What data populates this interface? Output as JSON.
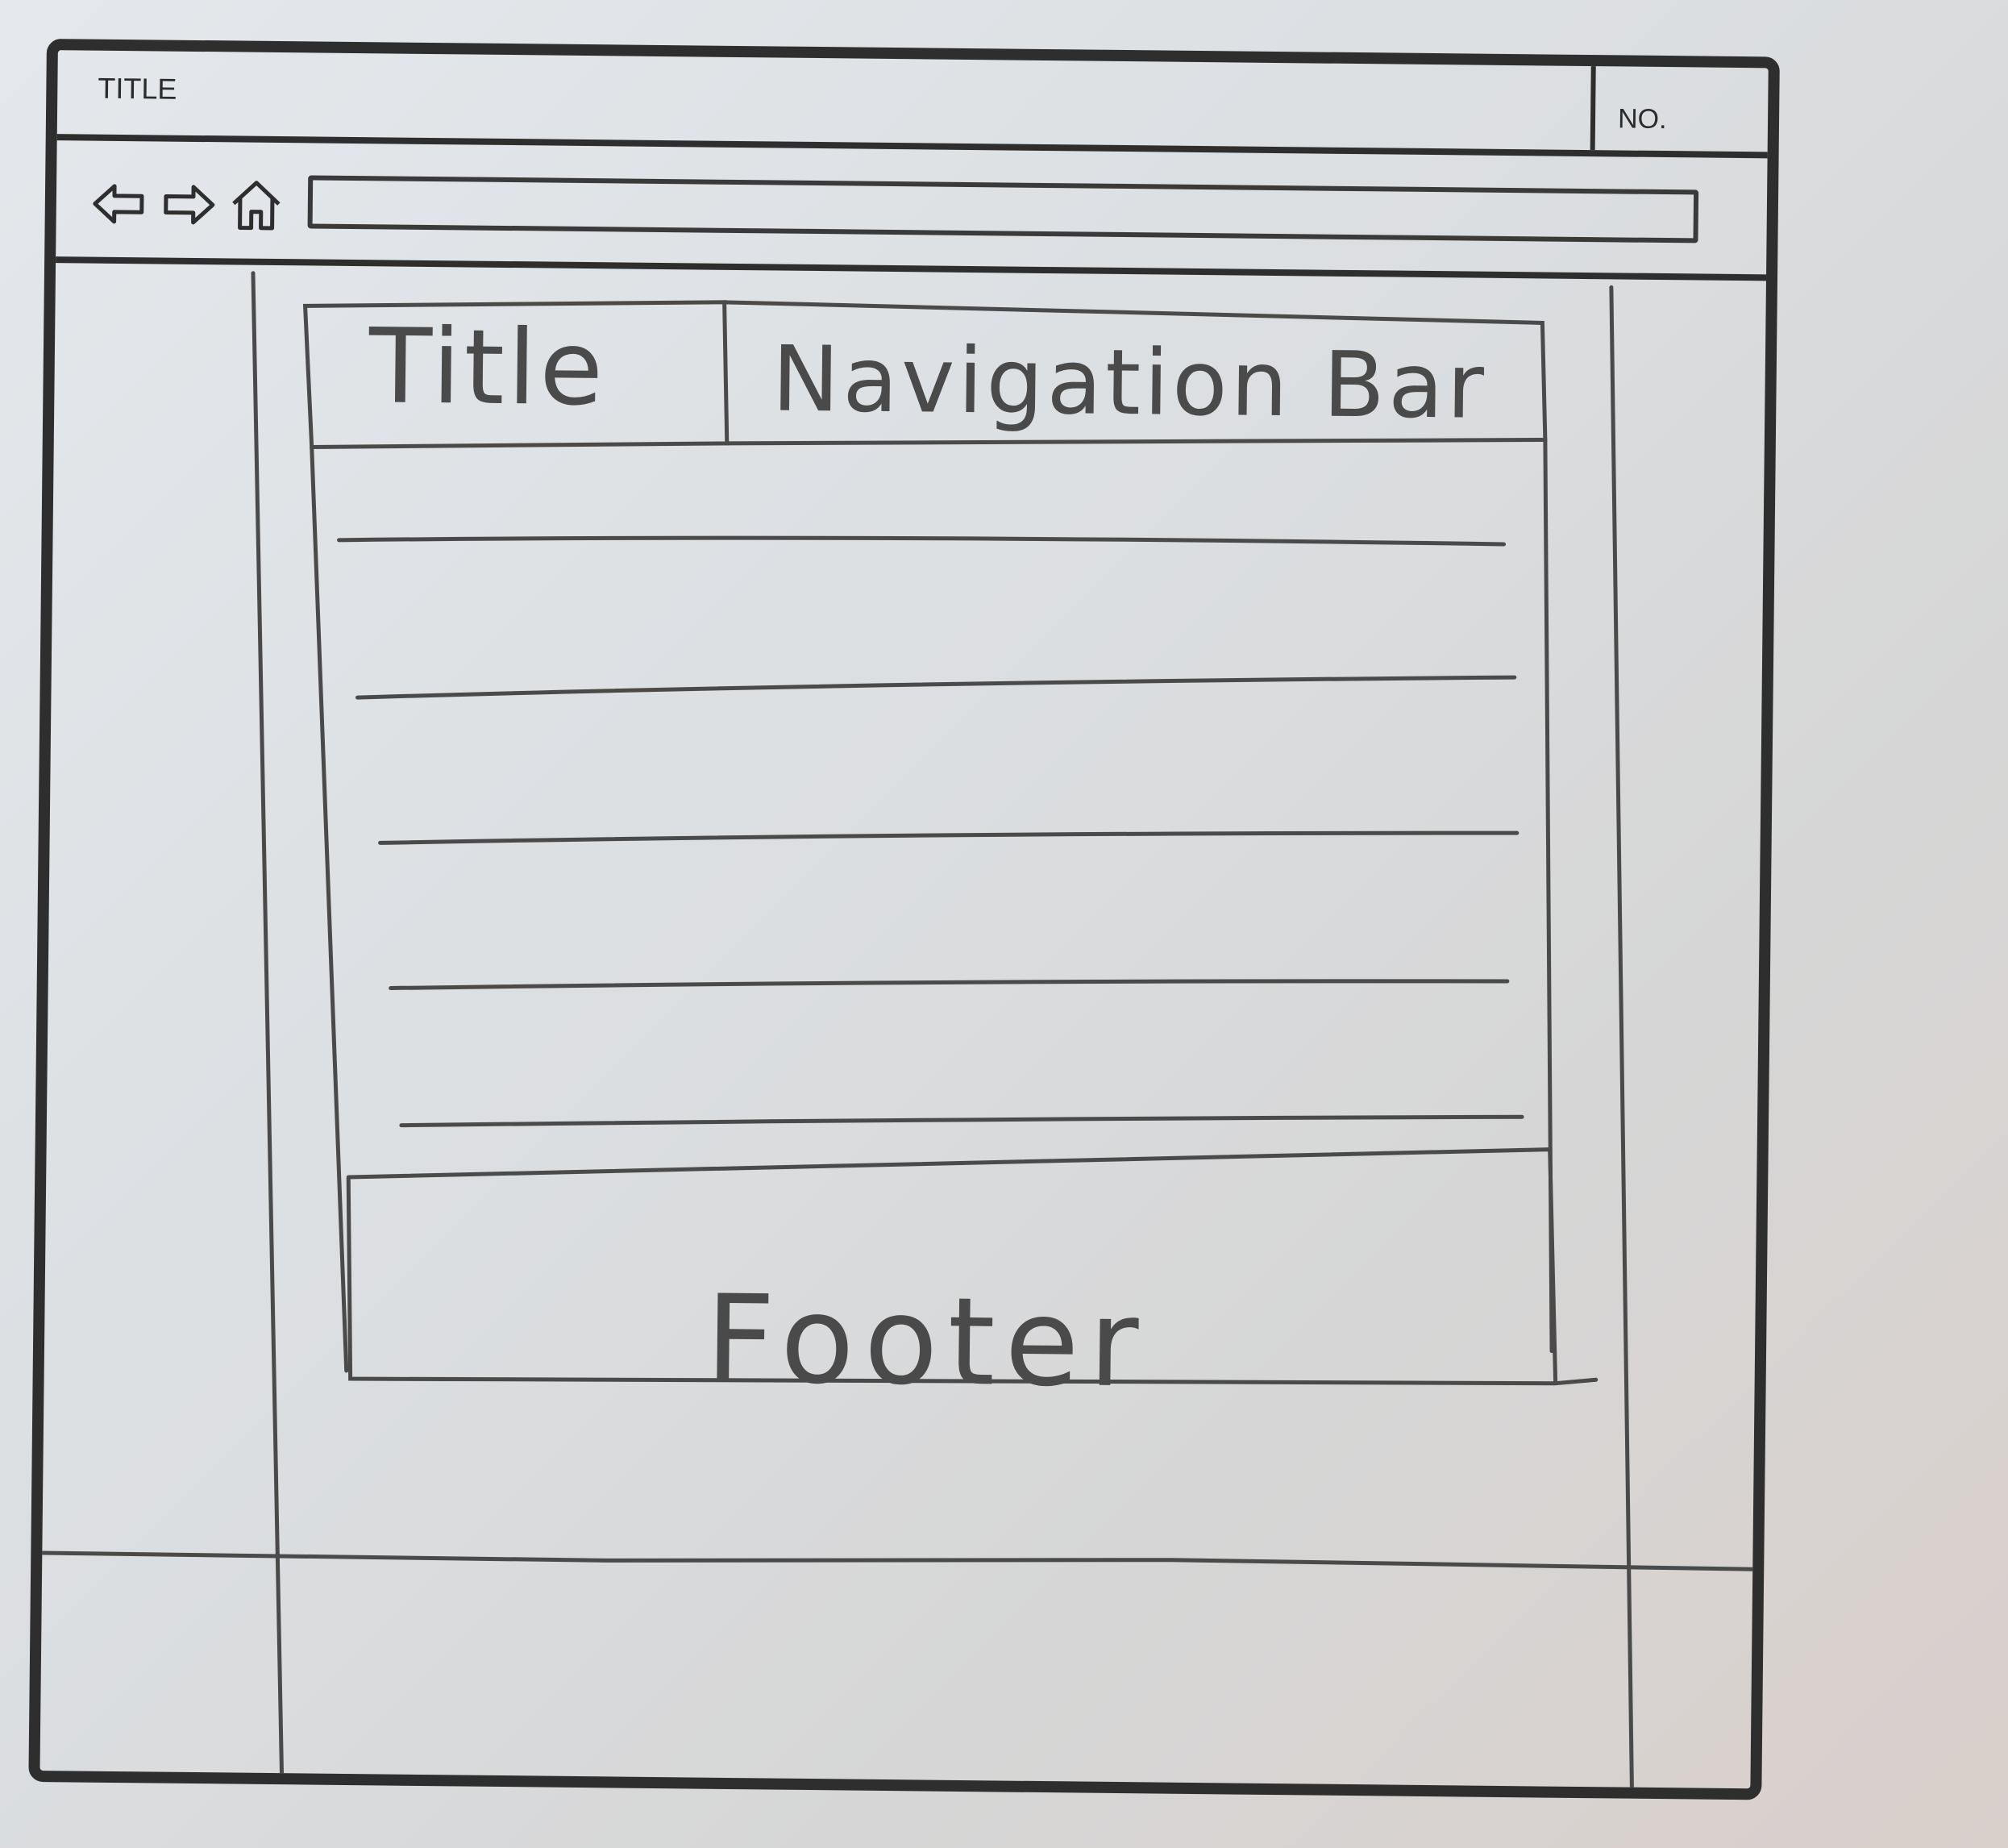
{
  "sheet": {
    "title_label": "TITLE",
    "number_label": "NO."
  },
  "browser": {
    "back_icon": "back-arrow-icon",
    "forward_icon": "forward-arrow-icon",
    "home_icon": "home-icon",
    "address_value": ""
  },
  "wireframe": {
    "header_title": "Title",
    "navigation_bar": "Navigation Bar",
    "content_lines": 5,
    "footer": "Footer"
  },
  "colors": {
    "ink": "#2e2e2e",
    "pencil": "#4a4a4a"
  }
}
